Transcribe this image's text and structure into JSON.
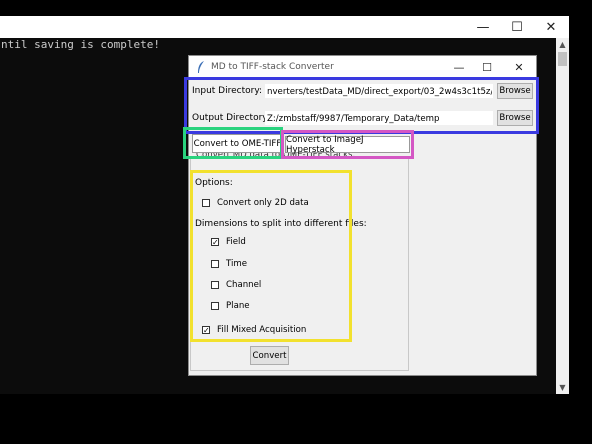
{
  "console": {
    "text": "ntil saving is complete!"
  },
  "app": {
    "title": "MD to TIFF-stack Converter",
    "input_label": "Input Directory:",
    "input_value": "nverters/testData_MD/direct_export/03_2w4s3c1t5z/3470",
    "output_label": "Output Directory:",
    "output_value": "Z:/zmbstaff/9987/Temporary_Data/temp",
    "browse_label": "Browse",
    "tabs": [
      {
        "label": "Convert to OME-TIFF"
      },
      {
        "label": "Convert to ImageJ Hyperstack"
      }
    ],
    "tab_description": "Convert MD data to OME-TIFF stacks.",
    "options_label": "Options:",
    "convert_2d_label": "Convert only 2D data",
    "dimensions_label": "Dimensions to split into different files:",
    "field_label": "Field",
    "time_label": "Time",
    "channel_label": "Channel",
    "plane_label": "Plane",
    "fill_mixed_label": "Fill Mixed Acquisition",
    "convert_label": "Convert",
    "checkmark": "✓",
    "checked": {
      "convert_2d": false,
      "field": true,
      "time": false,
      "channel": false,
      "plane": false,
      "fill_mixed": true
    }
  }
}
